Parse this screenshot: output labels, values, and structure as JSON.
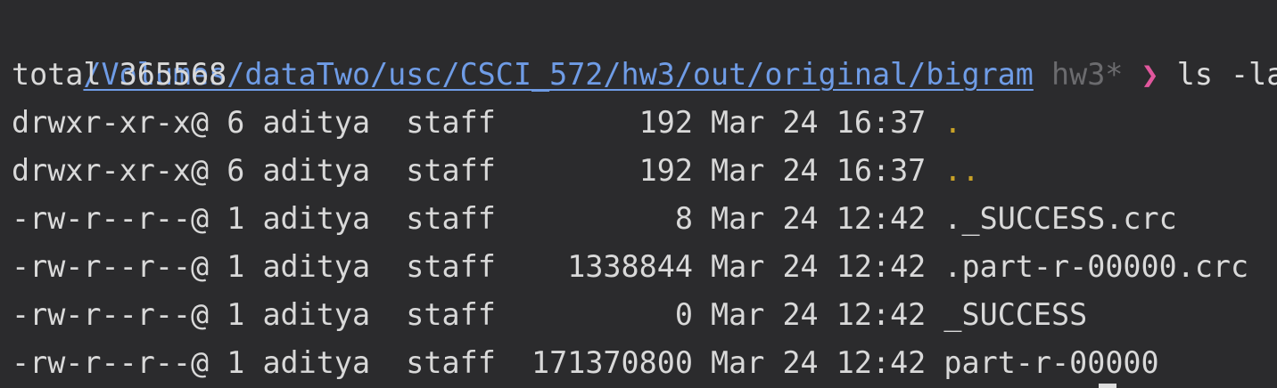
{
  "prompt": {
    "path": "/Volumes/dataTwo/usc/CSCI_572/hw3/out/original/bigram",
    "branch": "hw3*",
    "symbol": "❯",
    "command": "ls -la"
  },
  "output": {
    "total": "total 365568",
    "entries": [
      {
        "perms": "drwxr-xr-x@",
        "links": "6",
        "owner": "aditya",
        "group": "staff",
        "size": "192",
        "date": "Mar 24 16:37",
        "name": "."
      },
      {
        "perms": "drwxr-xr-x@",
        "links": "6",
        "owner": "aditya",
        "group": "staff",
        "size": "192",
        "date": "Mar 24 16:37",
        "name": ".."
      },
      {
        "perms": "-rw-r--r--@",
        "links": "1",
        "owner": "aditya",
        "group": "staff",
        "size": "8",
        "date": "Mar 24 12:42",
        "name": "._SUCCESS.crc"
      },
      {
        "perms": "-rw-r--r--@",
        "links": "1",
        "owner": "aditya",
        "group": "staff",
        "size": "1338844",
        "date": "Mar 24 12:42",
        "name": ".part-r-00000.crc"
      },
      {
        "perms": "-rw-r--r--@",
        "links": "1",
        "owner": "aditya",
        "group": "staff",
        "size": "0",
        "date": "Mar 24 12:42",
        "name": "_SUCCESS"
      },
      {
        "perms": "-rw-r--r--@",
        "links": "1",
        "owner": "aditya",
        "group": "staff",
        "size": "171370800",
        "date": "Mar 24 12:42",
        "name": "part-r-00000"
      }
    ]
  },
  "colors": {
    "background": "#2b2b2d",
    "path": "#6f9ce6",
    "branch": "#6b6b6e",
    "prompt_symbol": "#e1579d",
    "text": "#dcdcdc",
    "dir_dots": "#c9a227"
  }
}
